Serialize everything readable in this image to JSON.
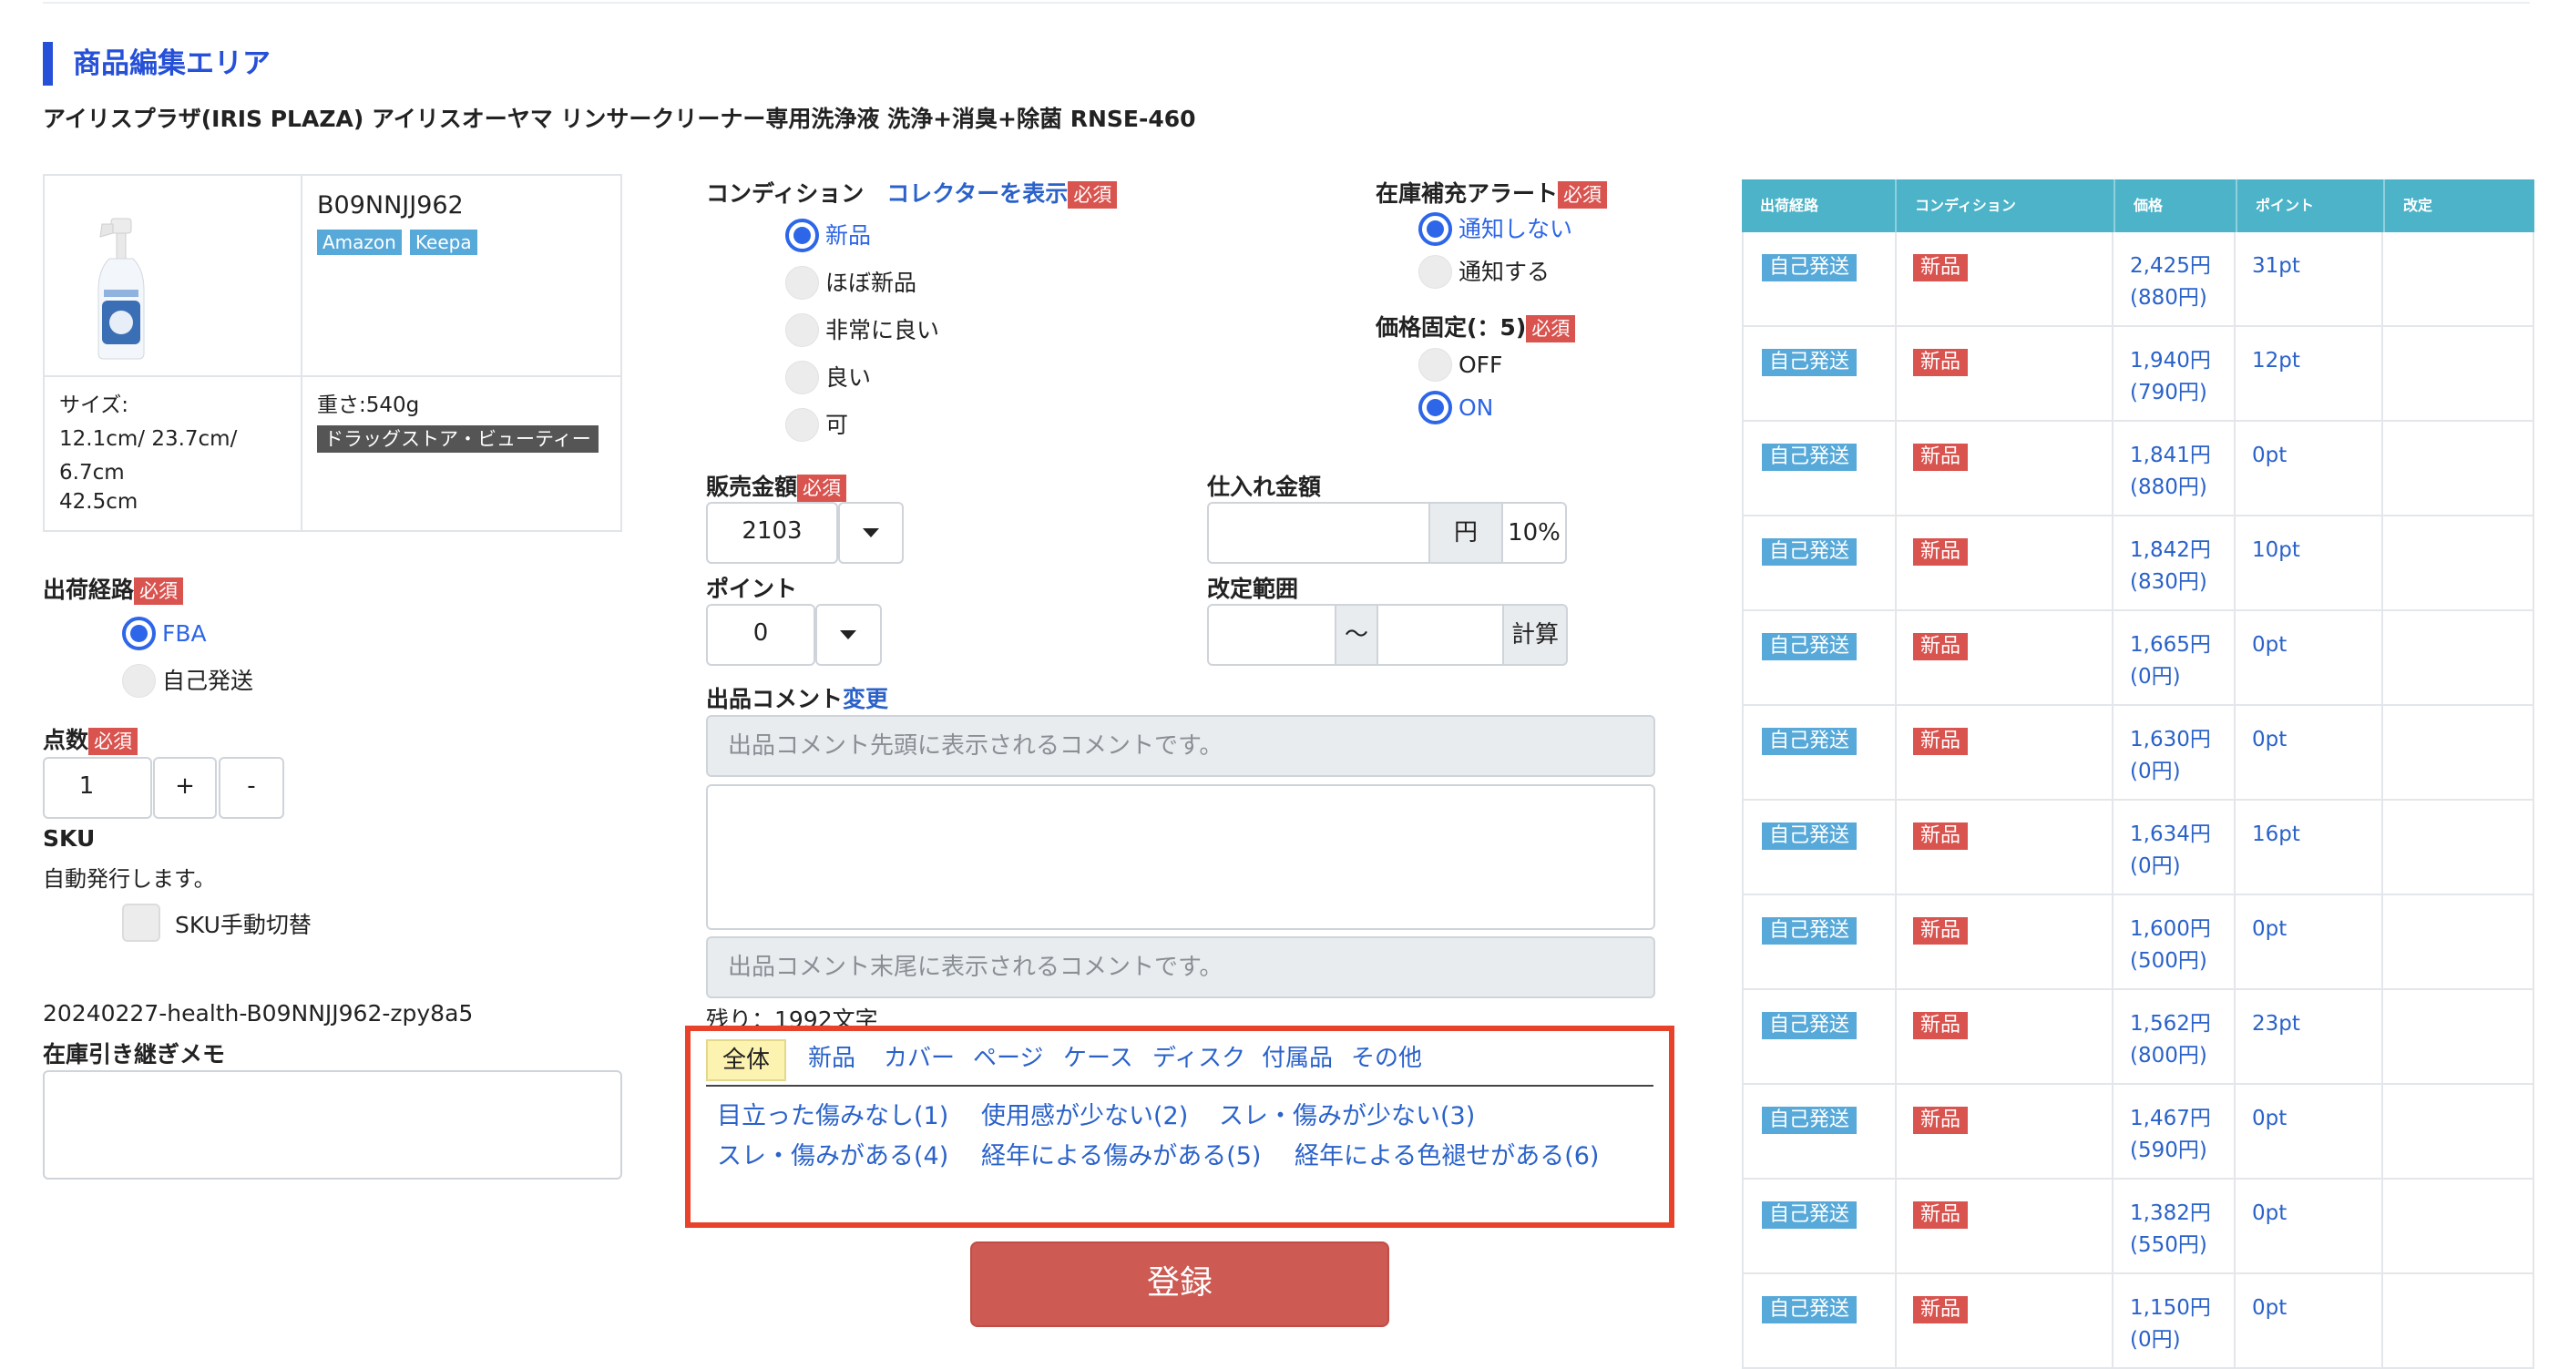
{
  "header": {
    "section_title": "商品編集エリア",
    "product_name": "アイリスプラザ(IRIS PLAZA) アイリスオーヤマ リンサークリーナー専用洗浄液 洗浄+消臭+除菌 RNSE-460"
  },
  "product": {
    "asin": "B09NNJJ962",
    "links": [
      "Amazon",
      "Keepa"
    ],
    "size_label": "サイズ:",
    "size_lines": [
      "12.1cm/ 23.7cm/",
      "6.7cm",
      "42.5cm"
    ],
    "weight": "重さ:540g",
    "category": "ドラッグストア・ビューティー"
  },
  "required": "必須",
  "shipping": {
    "label": "出荷経路",
    "options": [
      "FBA",
      "自己発送"
    ],
    "selected": 0
  },
  "quantity": {
    "label": "点数",
    "value": "1",
    "plus": "+",
    "minus": "-"
  },
  "sku": {
    "label": "SKU",
    "auto_text": "自動発行します。",
    "manual_toggle_label": "SKU手動切替",
    "code": "20240227-health-B09NNJJ962-zpy8a5"
  },
  "memo": {
    "label": "在庫引き継ぎメモ",
    "value": ""
  },
  "condition": {
    "label": "コンディション",
    "collector_link": "コレクターを表示",
    "options": [
      "新品",
      "ほぼ新品",
      "非常に良い",
      "良い",
      "可"
    ],
    "selected": 0
  },
  "restock_alert": {
    "label": "在庫補充アラート",
    "options": [
      "通知しない",
      "通知する"
    ],
    "selected": 0
  },
  "price_fixed": {
    "label": "価格固定(：5)",
    "options": [
      "OFF",
      "ON"
    ],
    "selected": 1
  },
  "sale_price": {
    "label": "販売金額",
    "value": "2103"
  },
  "purchase_price": {
    "label": "仕入れ金額",
    "value": "",
    "unit": "円",
    "rate": "10%"
  },
  "points": {
    "label": "ポイント",
    "value": "0"
  },
  "revision_range": {
    "label": "改定範囲",
    "from": "",
    "sep": "〜",
    "to": "",
    "calc_button": "計算"
  },
  "comment": {
    "label": "出品コメント",
    "change_link": "変更",
    "head_placeholder": "出品コメント先頭に表示されるコメントです。",
    "body": "",
    "tail_placeholder": "出品コメント末尾に表示されるコメントです。",
    "remaining": "残り：1992文字"
  },
  "template_tabs": {
    "tabs": [
      "全体",
      "新品",
      "カバー",
      "ページ",
      "ケース",
      "ディスク",
      "付属品",
      "その他"
    ],
    "active": 0,
    "templates": [
      "目立った傷みなし(1)",
      "使用感が少ない(2)",
      "スレ・傷みが少ない(3)",
      "スレ・傷みがある(4)",
      "経年による傷みがある(5)",
      "経年による色褪せがある(6)"
    ]
  },
  "submit_label": "登録",
  "offers_table": {
    "headers": [
      "出荷経路",
      "コンディション",
      "価格",
      "ポイント",
      "改定"
    ],
    "rows": [
      {
        "ship": "自己発送",
        "cond": "新品",
        "price": "2,425円",
        "shipping_fee": "(880円)",
        "points": "31pt"
      },
      {
        "ship": "自己発送",
        "cond": "新品",
        "price": "1,940円",
        "shipping_fee": "(790円)",
        "points": "12pt"
      },
      {
        "ship": "自己発送",
        "cond": "新品",
        "price": "1,841円",
        "shipping_fee": "(880円)",
        "points": "0pt"
      },
      {
        "ship": "自己発送",
        "cond": "新品",
        "price": "1,842円",
        "shipping_fee": "(830円)",
        "points": "10pt"
      },
      {
        "ship": "自己発送",
        "cond": "新品",
        "price": "1,665円",
        "shipping_fee": "(0円)",
        "points": "0pt"
      },
      {
        "ship": "自己発送",
        "cond": "新品",
        "price": "1,630円",
        "shipping_fee": "(0円)",
        "points": "0pt"
      },
      {
        "ship": "自己発送",
        "cond": "新品",
        "price": "1,634円",
        "shipping_fee": "(0円)",
        "points": "16pt"
      },
      {
        "ship": "自己発送",
        "cond": "新品",
        "price": "1,600円",
        "shipping_fee": "(500円)",
        "points": "0pt"
      },
      {
        "ship": "自己発送",
        "cond": "新品",
        "price": "1,562円",
        "shipping_fee": "(800円)",
        "points": "23pt"
      },
      {
        "ship": "自己発送",
        "cond": "新品",
        "price": "1,467円",
        "shipping_fee": "(590円)",
        "points": "0pt"
      },
      {
        "ship": "自己発送",
        "cond": "新品",
        "price": "1,382円",
        "shipping_fee": "(550円)",
        "points": "0pt"
      },
      {
        "ship": "自己発送",
        "cond": "新品",
        "price": "1,150円",
        "shipping_fee": "(0円)",
        "points": "0pt"
      }
    ]
  },
  "colors": {
    "accent_blue": "#2650d7",
    "required_red": "#d9534f",
    "table_header": "#4cb3c8",
    "highlight_frame": "#e8432a",
    "submit": "#cd5a53"
  }
}
